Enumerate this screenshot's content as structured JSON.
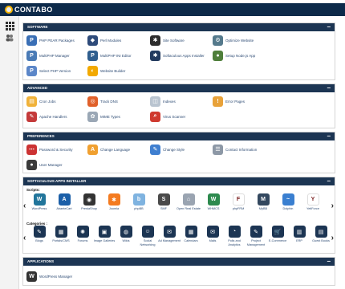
{
  "brand": {
    "name": "CONTABO"
  },
  "software": {
    "title": "SOFTWARE",
    "items": [
      {
        "label": "PHP PEAR Packages",
        "color": "#3a6fb5",
        "glyph": "P"
      },
      {
        "label": "Perl Modules",
        "color": "#2e4b7a",
        "glyph": "◆"
      },
      {
        "label": "Site Software",
        "color": "#2d2d2d",
        "glyph": "✱"
      },
      {
        "label": "Optimize Website",
        "color": "#557a8c",
        "glyph": "⚙"
      },
      {
        "label": "MultiPHP Manager",
        "color": "#4a7bb6",
        "glyph": "P"
      },
      {
        "label": "MultiPHP INI Editor",
        "color": "#2f5e8e",
        "glyph": "P"
      },
      {
        "label": "Softaculous Apps Installer",
        "color": "#223a5e",
        "glyph": "✱"
      },
      {
        "label": "Setup Node.js App",
        "color": "#4f7f3b",
        "glyph": "●"
      },
      {
        "label": "Select PHP Version",
        "color": "#5b86c8",
        "glyph": "P"
      },
      {
        "label": "Website Builder",
        "color": "#f2a900",
        "glyph": "◐"
      }
    ]
  },
  "advanced": {
    "title": "ADVANCED",
    "items": [
      {
        "label": "Cron Jobs",
        "color": "#f0b23a",
        "glyph": "▤"
      },
      {
        "label": "Track DNS",
        "color": "#e0602a",
        "glyph": "◎"
      },
      {
        "label": "Indexes",
        "color": "#b9c4d0",
        "glyph": "◫"
      },
      {
        "label": "Error Pages",
        "color": "#e8a23a",
        "glyph": "!"
      },
      {
        "label": "Apache Handlers",
        "color": "#c43a3a",
        "glyph": "✎"
      },
      {
        "label": "MIME Types",
        "color": "#9aa7b5",
        "glyph": "✿"
      },
      {
        "label": "Virus Scanner",
        "color": "#cf3a2f",
        "glyph": "⌕"
      }
    ]
  },
  "preferences": {
    "title": "PREFERENCES",
    "items": [
      {
        "label": "Password & Security",
        "color": "#cc3333",
        "glyph": "⋯"
      },
      {
        "label": "Change Language",
        "color": "#f0a030",
        "glyph": "A"
      },
      {
        "label": "Change Style",
        "color": "#3f7fd0",
        "glyph": "✎"
      },
      {
        "label": "Contact Information",
        "color": "#8d98a6",
        "glyph": "☰"
      },
      {
        "label": "User Manager",
        "color": "#3a3a3a",
        "glyph": "●"
      }
    ]
  },
  "softaculous": {
    "title": "SOFTACULOUS APPS INSTALLER",
    "scripts_label": "Scripts:",
    "scripts": [
      {
        "label": "WordPress",
        "color": "#21759b",
        "glyph": "W"
      },
      {
        "label": "AbanteCart",
        "color": "#1b5fa8",
        "glyph": "A"
      },
      {
        "label": "PrestaShop",
        "color": "#333333",
        "glyph": "◉"
      },
      {
        "label": "Joomla",
        "color": "#f47b20",
        "glyph": "✱"
      },
      {
        "label": "phpBB",
        "color": "#7fb3e0",
        "glyph": "b"
      },
      {
        "label": "SMF",
        "color": "#4a4a4a",
        "glyph": "S"
      },
      {
        "label": "Open Real Estate",
        "color": "#9aa4b1",
        "glyph": "⌂"
      },
      {
        "label": "WHMCS",
        "color": "#2d8a4e",
        "glyph": "W"
      },
      {
        "label": "phpFRM",
        "color": "#ffffff",
        "glyph": "F"
      },
      {
        "label": "MyBB",
        "color": "#33485f",
        "glyph": "M"
      },
      {
        "label": "Dolphin",
        "color": "#3a7fd0",
        "glyph": "~"
      },
      {
        "label": "YetiForce",
        "color": "#ffffff",
        "glyph": "Y"
      }
    ],
    "categories_label": "Categories :",
    "categories": [
      {
        "label": "Blogs",
        "glyph": "✎"
      },
      {
        "label": "Portals/CMS",
        "glyph": "▦"
      },
      {
        "label": "Forums",
        "glyph": "✺"
      },
      {
        "label": "Image Galleries",
        "glyph": "▣"
      },
      {
        "label": "Wikis",
        "glyph": "◍"
      },
      {
        "label": "Social Networking",
        "glyph": "☺"
      },
      {
        "label": "Ad Management",
        "glyph": "✉"
      },
      {
        "label": "Calendars",
        "glyph": "▦"
      },
      {
        "label": "Mails",
        "glyph": "✉"
      },
      {
        "label": "Polls and Analytics",
        "glyph": "◔"
      },
      {
        "label": "Project Management",
        "glyph": "✎"
      },
      {
        "label": "E-Commerce",
        "glyph": "🛒"
      },
      {
        "label": "ERP",
        "glyph": "▥"
      },
      {
        "label": "Guest Books",
        "glyph": "▤"
      }
    ]
  },
  "applications": {
    "title": "APPLICATIONS",
    "items": [
      {
        "label": "WordPress Manager",
        "color": "#333333",
        "glyph": "W"
      }
    ]
  }
}
